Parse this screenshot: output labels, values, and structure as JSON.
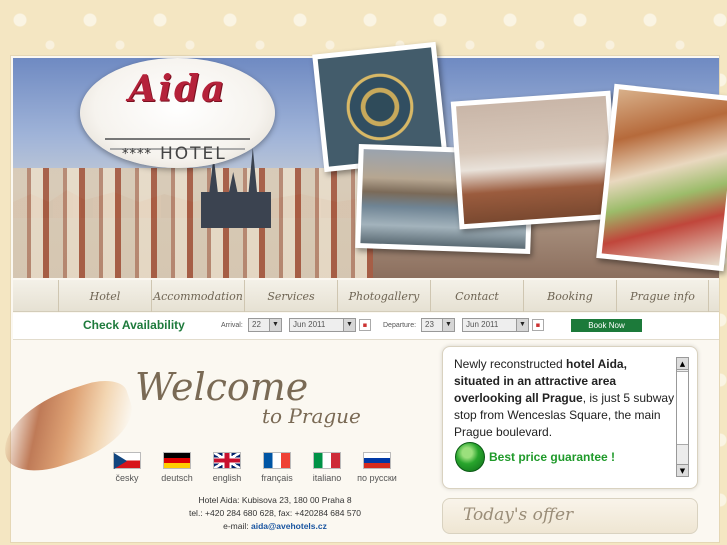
{
  "logo": {
    "name": "Aida",
    "stars": "****",
    "hotel": "HOTEL"
  },
  "nav": [
    "Hotel",
    "Accommodation",
    "Services",
    "Photogallery",
    "Contact",
    "Booking",
    "Prague info"
  ],
  "availability": {
    "title": "Check Availability",
    "arrival_label": "Arrival:",
    "arrival_day": "22",
    "arrival_month": "Jun 2011",
    "departure_label": "Departure:",
    "departure_day": "23",
    "departure_month": "Jun 2011",
    "book_label": "Book Now"
  },
  "welcome": {
    "title": "Welcome",
    "subtitle": "to Prague"
  },
  "languages": [
    {
      "label": "česky",
      "colors": [
        "#ffffff",
        "#d7141a",
        "#11457e"
      ]
    },
    {
      "label": "deutsch",
      "colors": [
        "#000000",
        "#dd0000",
        "#ffce00"
      ]
    },
    {
      "label": "english",
      "colors": [
        "#012169",
        "#ffffff",
        "#c8102e"
      ]
    },
    {
      "label": "français",
      "colors": [
        "#0055a4",
        "#ffffff",
        "#ef4135"
      ]
    },
    {
      "label": "italiano",
      "colors": [
        "#009246",
        "#ffffff",
        "#ce2b37"
      ]
    },
    {
      "label": "по русски",
      "colors": [
        "#ffffff",
        "#0039a6",
        "#d52b1e"
      ]
    }
  ],
  "contact": {
    "address": "Hotel Aida: Kubisova 23, 180 00 Praha 8",
    "phone": "tel.: +420 284 680 628, fax: +420284 684 570",
    "email_label": "e-mail: ",
    "email": "aida@avehotels.cz"
  },
  "info": {
    "intro": "Newly reconstructed ",
    "bold": "hotel Aida, situated in an attractive area overlooking all Prague",
    "rest": ", is just 5 subway stop from Wenceslas Square, the main Prague boulevard.",
    "guarantee": "Best price guarantee !"
  },
  "offer": {
    "title": "Today's offer"
  },
  "colors": {
    "accent_green": "#1c7a3a",
    "logo_red": "#b5223a"
  }
}
